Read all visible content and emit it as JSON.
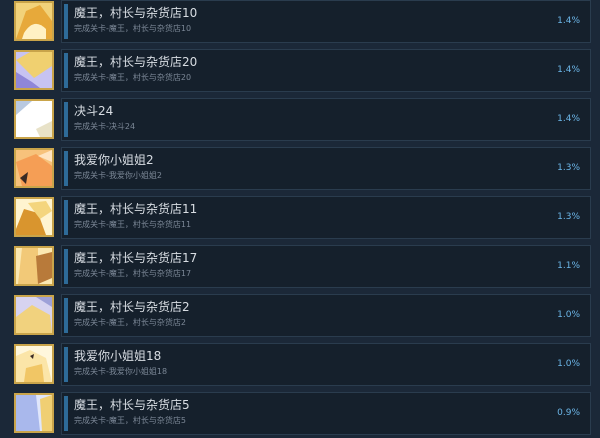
{
  "achievements": [
    {
      "title": "魔王，村长与杂货店10",
      "subtitle": "完成关卡-魔王，村长与杂货店10",
      "percent": "1.4%",
      "icon": "anime-girl-yellow-icon",
      "colors": [
        "#f2d27a",
        "#e7a93a",
        "#fff1c4"
      ]
    },
    {
      "title": "魔王，村长与杂货店20",
      "subtitle": "完成关卡-魔王，村长与杂货店20",
      "percent": "1.4%",
      "icon": "anime-girl-purple-icon",
      "colors": [
        "#c7c3f2",
        "#f0d070",
        "#8f86d8"
      ]
    },
    {
      "title": "决斗24",
      "subtitle": "完成关卡-决斗24",
      "percent": "1.4%",
      "icon": "white-card-icon",
      "colors": [
        "#ffffff",
        "#e8e2c8",
        "#b9c9e0"
      ]
    },
    {
      "title": "我爱你小姐姐2",
      "subtitle": "完成关卡-我爱你小姐姐2",
      "percent": "1.3%",
      "icon": "anime-girl-orange-icon",
      "colors": [
        "#f7c27b",
        "#f59e55",
        "#ffe4c1"
      ]
    },
    {
      "title": "魔王，村长与杂货店11",
      "subtitle": "完成关卡-魔王，村长与杂货店11",
      "percent": "1.3%",
      "icon": "anime-girl-gold-icon",
      "colors": [
        "#f4d57e",
        "#d9952e",
        "#fff4d0"
      ]
    },
    {
      "title": "魔王，村长与杂货店17",
      "subtitle": "完成关卡-魔王，村长与杂货店17",
      "percent": "1.1%",
      "icon": "anime-girl-brown-icon",
      "colors": [
        "#f2c978",
        "#b87a3a",
        "#fbe8b2"
      ]
    },
    {
      "title": "魔王，村长与杂货店2",
      "subtitle": "完成关卡-魔王，村长与杂货店2",
      "percent": "1.0%",
      "icon": "anime-girl-lavender-icon",
      "colors": [
        "#d7d3f0",
        "#f1d27e",
        "#9ea0d8"
      ]
    },
    {
      "title": "我爱你小姐姐18",
      "subtitle": "完成关卡-我爱你小姐姐18",
      "percent": "1.0%",
      "icon": "anime-girl-cream-icon",
      "colors": [
        "#fbe5a8",
        "#f1c665",
        "#fff7dc"
      ]
    },
    {
      "title": "魔王，村长与杂货店5",
      "subtitle": "完成关卡-魔王，村长与杂货店5",
      "percent": "0.9%",
      "icon": "anime-girl-blue-icon",
      "colors": [
        "#a9b8ec",
        "#f0cf73",
        "#dfe6fb"
      ]
    }
  ]
}
